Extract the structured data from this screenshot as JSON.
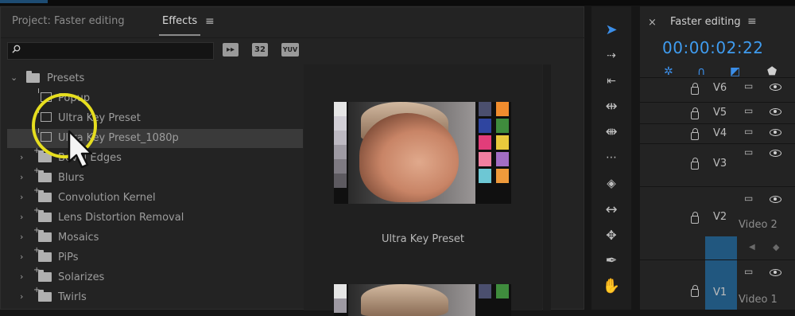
{
  "tabs": {
    "project_label": "Project: Faster editing",
    "effects_label": "Effects",
    "menu_glyph": "≡"
  },
  "search": {
    "value": "",
    "icon": "magnifier"
  },
  "toolbar_icons": [
    {
      "name": "accelerated-effects-icon",
      "text": "▸▸"
    },
    {
      "name": "32-bit-effects-icon",
      "text": "32"
    },
    {
      "name": "yuv-effects-icon",
      "text": "YUV"
    }
  ],
  "tree": {
    "presets_folder": "Presets",
    "items": [
      {
        "label": "Popup",
        "type": "preset"
      },
      {
        "label": "Ultra Key Preset",
        "type": "preset"
      },
      {
        "label": "Ultra Key Preset_1080p",
        "type": "preset",
        "selected": true
      },
      {
        "label": "Bevel Edges",
        "type": "folder"
      },
      {
        "label": "Blurs",
        "type": "folder"
      },
      {
        "label": "Convolution Kernel",
        "type": "folder"
      },
      {
        "label": "Lens Distortion Removal",
        "type": "folder"
      },
      {
        "label": "Mosaics",
        "type": "folder"
      },
      {
        "label": "PiPs",
        "type": "folder"
      },
      {
        "label": "Solarizes",
        "type": "folder"
      },
      {
        "label": "Twirls",
        "type": "folder"
      }
    ]
  },
  "preview": {
    "caption": "Ultra Key Preset",
    "swatch_colors": [
      "#e6e6e6",
      "#d2cfd6",
      "#bdb9c2",
      "#9e9aa3",
      "#7e7a82",
      "#5d5a60",
      "#4b4f6e",
      "#f08c2e",
      "#2f45a0",
      "#3f8c3d",
      "#e23d7a",
      "#e9c93c",
      "#f07fa0",
      "#a36dc4",
      "#6dc7d4",
      "#ef9a3b"
    ]
  },
  "timeline": {
    "close_glyph": "×",
    "title": "Faster editing",
    "menu_glyph": "≡",
    "timecode": "00:00:02:22",
    "tracks": [
      {
        "name": "V6",
        "label": ""
      },
      {
        "name": "V5",
        "label": ""
      },
      {
        "name": "V4",
        "label": ""
      },
      {
        "name": "V3",
        "label": ""
      },
      {
        "name": "V2",
        "label": "Video 2"
      },
      {
        "name": "V1",
        "label": "Video 1"
      }
    ]
  },
  "colors": {
    "accent_blue": "#3b8ee8",
    "timecode_blue": "#3f9cf0",
    "highlight_yellow": "#e6de1f",
    "target_track": "#21577f"
  }
}
